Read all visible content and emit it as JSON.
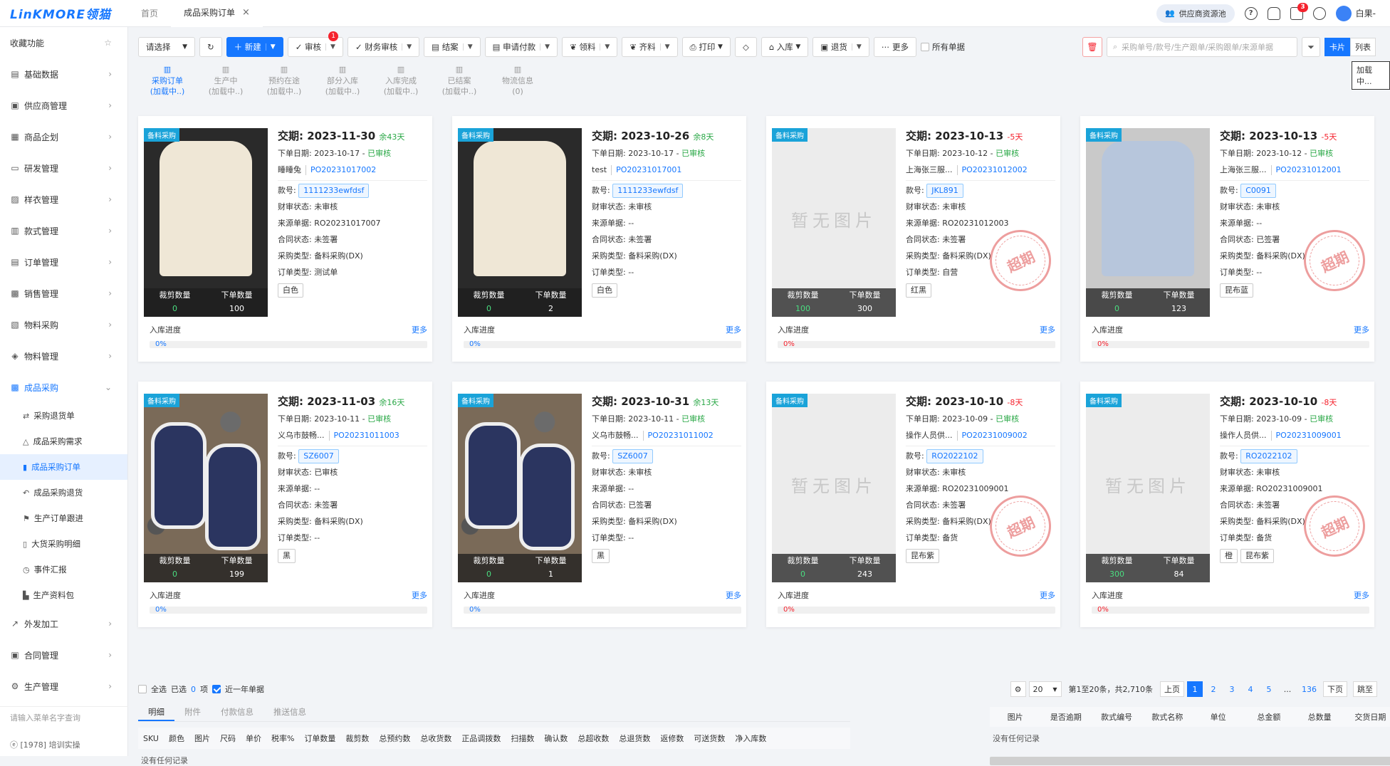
{
  "topbar": {
    "logo": "LinKMORE领猫",
    "tabs": [
      {
        "label": "首页"
      },
      {
        "label": "成品采购订单"
      }
    ],
    "close": "×",
    "supplier_pill": "供应商资源池",
    "help": "?",
    "notify_badge": "3",
    "user": "白果-"
  },
  "sidebar": {
    "favorites": "收藏功能",
    "items": [
      {
        "label": "基础数据",
        "icon": "book-icon"
      },
      {
        "label": "供应商管理",
        "icon": "folder-icon"
      },
      {
        "label": "商品企划",
        "icon": "calendar-icon"
      },
      {
        "label": "研发管理",
        "icon": "id-card-icon"
      },
      {
        "label": "样衣管理",
        "icon": "image-icon"
      },
      {
        "label": "款式管理",
        "icon": "truck-icon"
      },
      {
        "label": "订单管理",
        "icon": "document-icon"
      },
      {
        "label": "销售管理",
        "icon": "bank-icon"
      },
      {
        "label": "物料采购",
        "icon": "cart-icon"
      },
      {
        "label": "物料管理",
        "icon": "cube-icon"
      },
      {
        "label": "成品采购",
        "icon": "bank-icon"
      }
    ],
    "subitems": [
      {
        "label": "采购退货单"
      },
      {
        "label": "成品采购需求"
      },
      {
        "label": "成品采购订单"
      },
      {
        "label": "成品采购退货"
      },
      {
        "label": "生产订单跟进"
      },
      {
        "label": "大货采购明细"
      },
      {
        "label": "事件汇报"
      },
      {
        "label": "生产资料包"
      }
    ],
    "bottom_items": [
      {
        "label": "外发加工"
      },
      {
        "label": "合同管理"
      },
      {
        "label": "生产管理"
      }
    ],
    "search_placeholder": "请输入菜单名字查询",
    "footer": "ⓔ [1978] 培训实操"
  },
  "toolbar": {
    "select": "请选择",
    "new": "新建",
    "audit": "审核",
    "audit_badge": "1",
    "finance": "财务审核",
    "close": "结案",
    "payment": "申请付款",
    "pick": "领料",
    "kit": "齐料",
    "print": "打印",
    "stock_in": "入库",
    "return": "退货",
    "more": "更多",
    "all_orders": "所有单据",
    "search_placeholder": "采购单号/款号/生产跟单/采购跟单/来源单据",
    "view_card": "卡片",
    "view_list": "列表",
    "tooltip": "加载中..."
  },
  "status": [
    {
      "label": "采购订单",
      "sub": "(加载中..)"
    },
    {
      "label": "生产中",
      "sub": "(加载中..)"
    },
    {
      "label": "预约在途",
      "sub": "(加载中..)"
    },
    {
      "label": "部分入库",
      "sub": "(加载中..)"
    },
    {
      "label": "入库完成",
      "sub": "(加载中..)"
    },
    {
      "label": "已结案",
      "sub": "(加载中..)"
    },
    {
      "label": "物流信息",
      "sub": "(0)"
    }
  ],
  "labels": {
    "due": "交期:",
    "order_date": "下单日期:",
    "audited": "已审核",
    "style": "款号:",
    "fin": "财审状态:",
    "source": "来源单据:",
    "contract": "合同状态:",
    "ptype": "采购类型:",
    "otype": "订单类型:",
    "cut": "裁剪数量",
    "ordered": "下单数量",
    "progress": "入库进度",
    "more": "更多",
    "tag": "备料采购",
    "noimg": "暂无图片",
    "stamp": "超期"
  },
  "cards": [
    {
      "due": "2023-11-30",
      "days": "余43天",
      "late": false,
      "date": "2023-10-17",
      "person": "睡睡兔",
      "po": "PO20231017002",
      "style": "1111233ewfdsf",
      "fin": "未审核",
      "source": "RO20231017007",
      "contract": "未签署",
      "ptype": "备料采购(DX)",
      "otype": "测试单",
      "colors": [
        "白色"
      ],
      "cut": "0",
      "qty": "100",
      "pct": "0%",
      "img": "garment",
      "overdue": false
    },
    {
      "due": "2023-10-26",
      "days": "余8天",
      "late": false,
      "date": "2023-10-17",
      "person": "test",
      "po": "PO20231017001",
      "style": "1111233ewfdsf",
      "fin": "未审核",
      "source": "--",
      "contract": "未签署",
      "ptype": "备料采购(DX)",
      "otype": "--",
      "colors": [
        "白色"
      ],
      "cut": "0",
      "qty": "2",
      "pct": "0%",
      "img": "garment",
      "overdue": false
    },
    {
      "due": "2023-10-13",
      "days": "-5天",
      "late": true,
      "date": "2023-10-12",
      "person": "上海张三服...",
      "po": "PO20231012002",
      "style": "JKL891",
      "fin": "未审核",
      "source": "RO20231012003",
      "contract": "未签署",
      "ptype": "备料采购(DX)",
      "otype": "自营",
      "colors": [
        "红黑"
      ],
      "cut": "100",
      "qty": "300",
      "pct": "0%",
      "img": "none",
      "overdue": true
    },
    {
      "due": "2023-10-13",
      "days": "-5天",
      "late": true,
      "date": "2023-10-12",
      "person": "上海张三服...",
      "po": "PO20231012001",
      "style": "C0091",
      "fin": "未审核",
      "source": "--",
      "contract": "已签署",
      "ptype": "备料采购(DX)",
      "otype": "--",
      "colors": [
        "昆布蓝"
      ],
      "cut": "0",
      "qty": "123",
      "pct": "0%",
      "img": "shirt",
      "overdue": true
    },
    {
      "due": "2023-11-03",
      "days": "余16天",
      "late": false,
      "date": "2023-10-11",
      "person": "义乌市鼓畅...",
      "po": "PO20231011003",
      "style": "SZ6007",
      "fin": "已审核",
      "source": "--",
      "contract": "未签署",
      "ptype": "备料采购(DX)",
      "otype": "--",
      "colors": [
        "黑"
      ],
      "cut": "0",
      "qty": "199",
      "pct": "0%",
      "img": "shoes",
      "overdue": false
    },
    {
      "due": "2023-10-31",
      "days": "余13天",
      "late": false,
      "date": "2023-10-11",
      "person": "义乌市鼓畅...",
      "po": "PO20231011002",
      "style": "SZ6007",
      "fin": "未审核",
      "source": "--",
      "contract": "已签署",
      "ptype": "备料采购(DX)",
      "otype": "--",
      "colors": [
        "黑"
      ],
      "cut": "0",
      "qty": "1",
      "pct": "0%",
      "img": "shoes",
      "overdue": false
    },
    {
      "due": "2023-10-10",
      "days": "-8天",
      "late": true,
      "date": "2023-10-09",
      "person": "操作人员供...",
      "po": "PO20231009002",
      "style": "RO2022102",
      "fin": "未审核",
      "source": "RO20231009001",
      "contract": "未签署",
      "ptype": "备料采购(DX)",
      "otype": "备货",
      "colors": [
        "昆布紫"
      ],
      "cut": "0",
      "qty": "243",
      "pct": "0%",
      "img": "none",
      "overdue": true
    },
    {
      "due": "2023-10-10",
      "days": "-8天",
      "late": true,
      "date": "2023-10-09",
      "person": "操作人员供...",
      "po": "PO20231009001",
      "style": "RO2022102",
      "fin": "未审核",
      "source": "RO20231009001",
      "contract": "未签署",
      "ptype": "备料采购(DX)",
      "otype": "备货",
      "colors": [
        "橙",
        "昆布紫"
      ],
      "cut": "300",
      "qty": "84",
      "pct": "0%",
      "img": "none",
      "overdue": true
    }
  ],
  "pager": {
    "select_all": "全选",
    "selected": "已选",
    "selected_count": "0",
    "selected_unit": "项",
    "recent": "近一年单据",
    "page_size": "20",
    "summary": "第1至20条，共2,710条",
    "prev": "上页",
    "pages": [
      "1",
      "2",
      "3",
      "4",
      "5",
      "...",
      "136"
    ],
    "next": "下页",
    "jump": "跳至"
  },
  "detail": {
    "tabs": [
      "明细",
      "附件",
      "付款信息",
      "推送信息"
    ],
    "cols": [
      "SKU",
      "颜色",
      "图片",
      "尺码",
      "单价",
      "税率%",
      "订单数量",
      "裁剪数",
      "总预约数",
      "总收货数",
      "正品调拨数",
      "扫描数",
      "确认数",
      "总超收数",
      "总退货数",
      "返修数",
      "可送货数",
      "净入库数"
    ],
    "empty": "没有任何记录"
  },
  "rtable": {
    "cols": [
      "图片",
      "是否逾期",
      "款式编号",
      "款式名称",
      "单位",
      "总金额",
      "总数量",
      "交货日期"
    ],
    "empty": "没有任何记录"
  }
}
